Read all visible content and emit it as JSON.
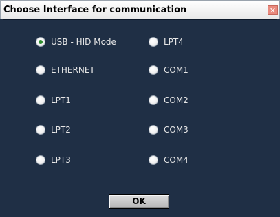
{
  "window": {
    "title": "Choose Interface for communication",
    "close_glyph": "✕"
  },
  "options": [
    {
      "label": "USB - HID Mode",
      "checked": true
    },
    {
      "label": "ETHERNET",
      "checked": false
    },
    {
      "label": "LPT1",
      "checked": false
    },
    {
      "label": "LPT2",
      "checked": false
    },
    {
      "label": "LPT3",
      "checked": false
    },
    {
      "label": "LPT4",
      "checked": false
    },
    {
      "label": "COM1",
      "checked": false
    },
    {
      "label": "COM2",
      "checked": false
    },
    {
      "label": "COM3",
      "checked": false
    },
    {
      "label": "COM4",
      "checked": false
    }
  ],
  "ok_button": {
    "label": "OK"
  },
  "colors": {
    "background": "#1f2f45",
    "label_text": "#e6e6e6",
    "radio_selected_dot": "#2f8d2f"
  }
}
